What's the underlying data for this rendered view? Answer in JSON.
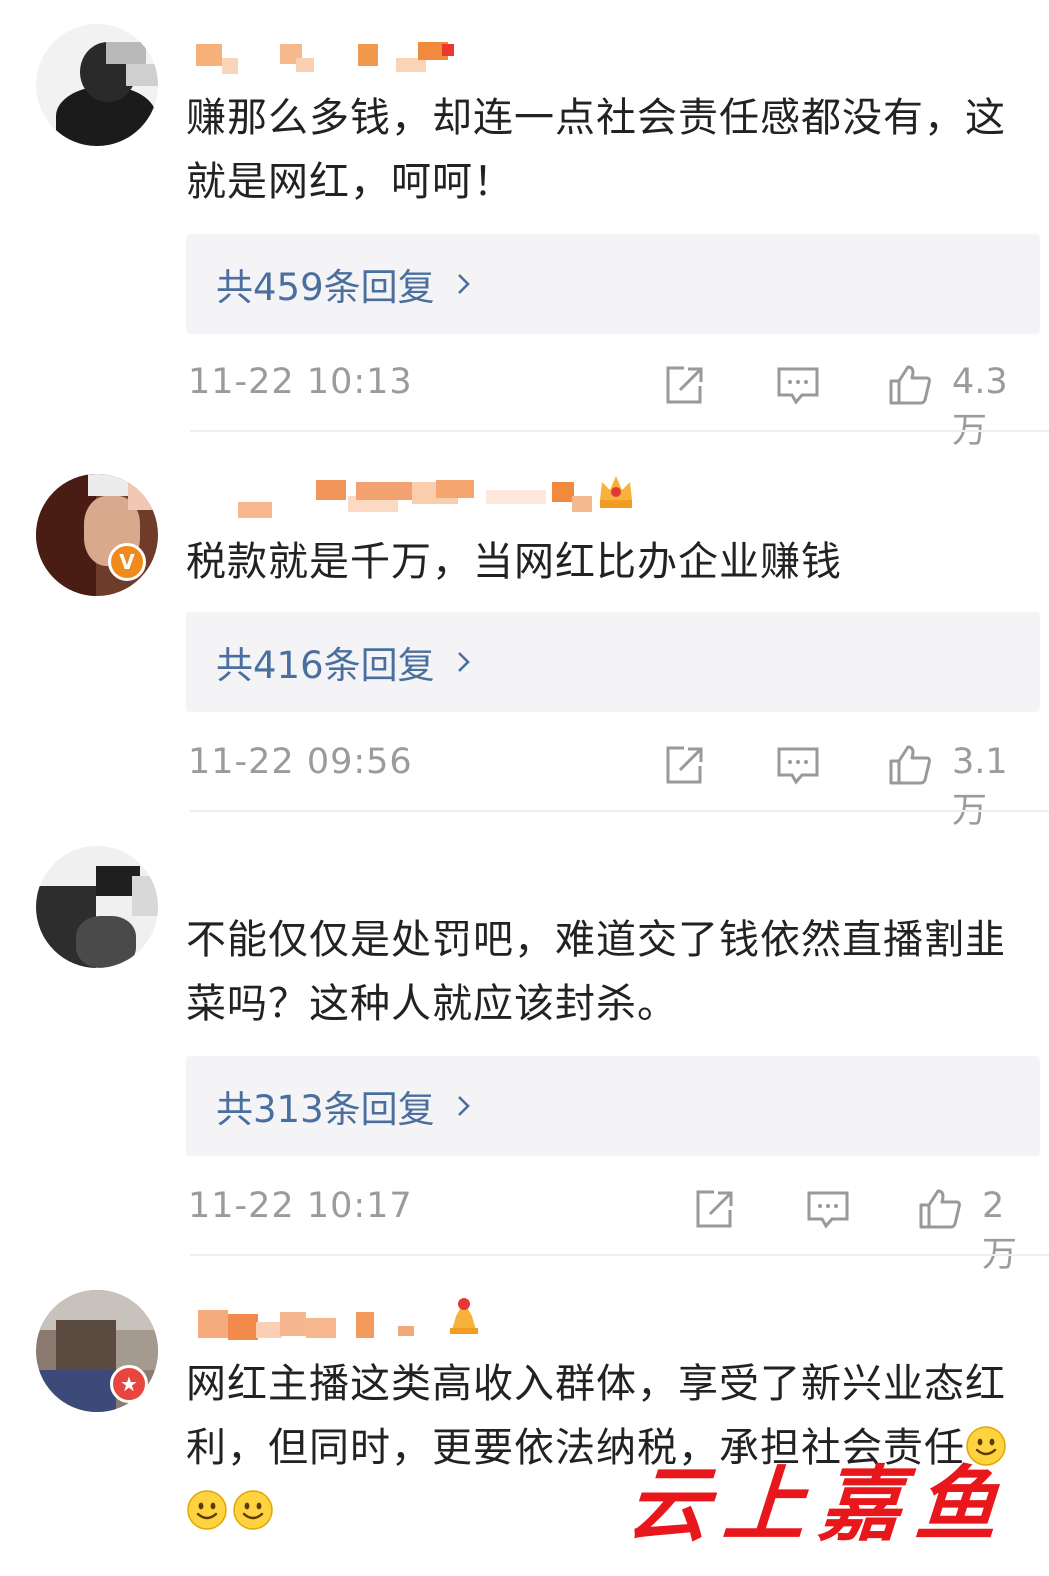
{
  "comments": [
    {
      "text": "赚那么多钱，却连一点社会责任感都没有，这就是网红，呵呵！",
      "replies": "共459条回复",
      "time": "11-22 10:13",
      "likes": "4.3万"
    },
    {
      "text": "税款就是千万，当网红比办企业赚钱",
      "replies": "共416条回复",
      "time": "11-22 09:56",
      "likes": "3.1万",
      "badge": "V"
    },
    {
      "text": "不能仅仅是处罚吧，难道交了钱依然直播割韭菜吗？这种人就应该封杀。",
      "replies": "共313条回复",
      "time": "11-22 10:17",
      "likes": "2万"
    },
    {
      "text": "网红主播这类高收入群体，享受了新兴业态红利，但同时，更要依法纳税，承担社会责任",
      "emoji_count": 3,
      "badge": "★"
    }
  ],
  "watermark": "云上嘉鱼",
  "colors": {
    "reply_link": "#4a6f9f",
    "reply_bg": "#f4f4f6",
    "meta_text": "#9b9b9b",
    "watermark": "#e8171b",
    "verified_orange": "#f08a1c",
    "badge_red": "#e7453d"
  },
  "icons": [
    "share-icon",
    "comment-icon",
    "like-icon",
    "chevron-right-icon",
    "smile-emoji"
  ]
}
